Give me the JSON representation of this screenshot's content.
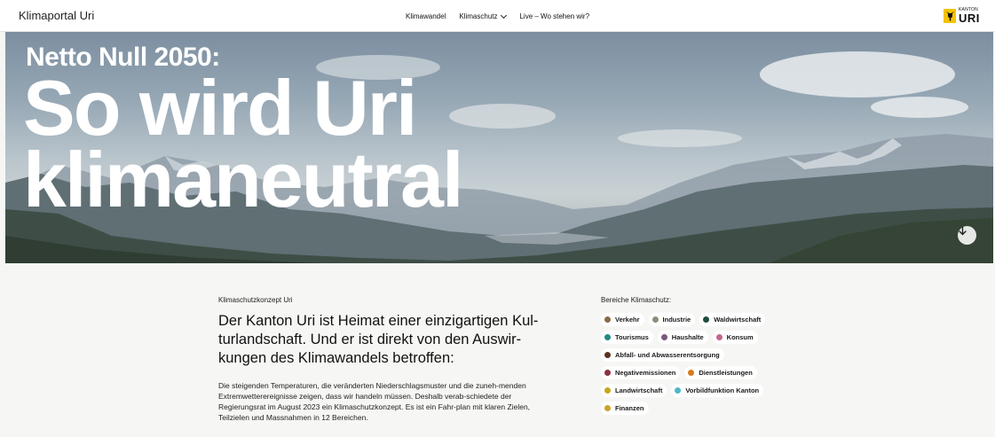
{
  "header": {
    "brand": "Klimaportal Uri",
    "nav": [
      {
        "label": "Klimawandel"
      },
      {
        "label": "Klimaschutz"
      },
      {
        "label": "Live – Wo stehen wir?"
      }
    ],
    "logo_small": "KANTON",
    "logo_big": "URI"
  },
  "hero": {
    "subtitle": "Netto Null 2050:",
    "title_line1": "So wird Uri",
    "title_line2": "klimaneutral"
  },
  "intro": {
    "eyebrow": "Klimaschutzkonzept Uri",
    "headline": "Der Kanton Uri ist Heimat einer einzigartigen Kul-turlandschaft. Und er ist direkt von den Auswir-kungen des Klimawandels betroffen:",
    "body": "Die steigenden Temperaturen, die veränderten Niederschlagsmuster und die zuneh-menden Extremwetterereignisse zeigen, dass wir handeln müssen. Deshalb verab-schiedete der Regierungsrat im August 2023 ein Klimaschutzkonzept. Es ist ein Fahr-plan mit klaren Zielen, Teilzielen und Massnahmen in 12 Bereichen."
  },
  "areas": {
    "label": "Bereiche Klimaschutz:",
    "items": [
      {
        "label": "Verkehr",
        "color": "#8b6a48"
      },
      {
        "label": "Industrie",
        "color": "#8a8f7a"
      },
      {
        "label": "Waldwirtschaft",
        "color": "#1f4d3c"
      },
      {
        "label": "Tourismus",
        "color": "#1f8a84"
      },
      {
        "label": "Haushalte",
        "color": "#7a5a7a"
      },
      {
        "label": "Konsum",
        "color": "#c2658f"
      },
      {
        "label": "Abfall- und Abwasserentsorgung",
        "color": "#5a3322"
      },
      {
        "label": "Negativemissionen",
        "color": "#8a3340"
      },
      {
        "label": "Dienstleistungen",
        "color": "#d97a1f"
      },
      {
        "label": "Landwirtschaft",
        "color": "#c4a818"
      },
      {
        "label": "Vorbildfunktion Kanton",
        "color": "#4cb8c9"
      },
      {
        "label": "Finanzen",
        "color": "#cda22a"
      }
    ]
  }
}
